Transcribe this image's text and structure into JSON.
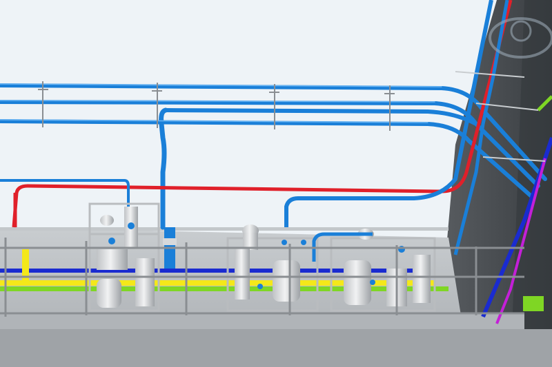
{
  "scene": {
    "description_label": "",
    "colors": {
      "sky": "#eef3f7",
      "wall": "#4e5256",
      "wall_dark": "#3c4044",
      "floor": "#b8bcc0",
      "floor_light": "#cfd3d6",
      "pipe_blue": "#1a7fd8",
      "pipe_blue_light": "#4aa3ef",
      "pipe_red": "#e0202a",
      "pipe_navy": "#1a2bd0",
      "pipe_magenta": "#c41fd8",
      "pipe_yellow": "#f4e81a",
      "pipe_green": "#7fd624",
      "equipment": "#d7d9db",
      "equipment_dark": "#a9adb0",
      "railing": "#8a8e92",
      "watermark": "#9aa8b4"
    },
    "icons": [
      "watermark-logo"
    ]
  }
}
